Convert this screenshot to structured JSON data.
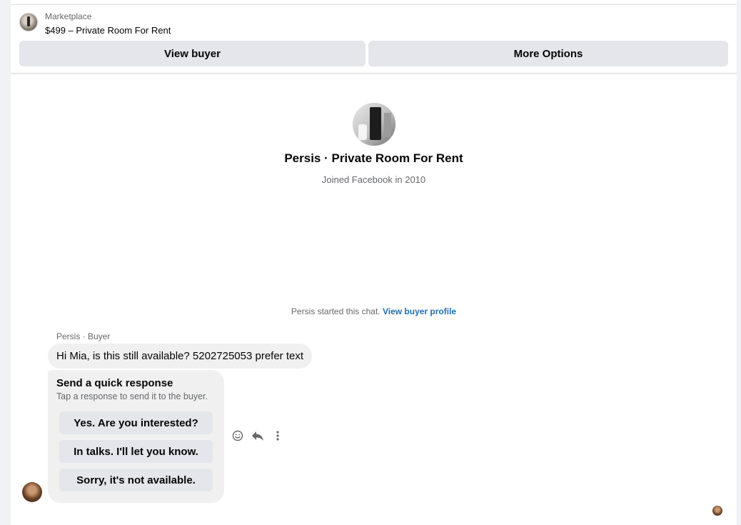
{
  "header": {
    "context_label": "Marketplace",
    "listing_title": "$499 – Private Room For Rent",
    "view_buyer_label": "View buyer",
    "more_options_label": "More Options"
  },
  "profile": {
    "name": "Persis · Private Room For Rent",
    "joined": "Joined Facebook in 2010"
  },
  "thread": {
    "started_text": "Persis started this chat.",
    "view_profile_link": "View buyer profile",
    "sender_label": "Persis · Buyer",
    "message": "Hi Mia, is this still available? 5202725053 prefer text"
  },
  "quick_response": {
    "title": "Send a quick response",
    "subtitle": "Tap a response to send it to the buyer.",
    "options": [
      "Yes. Are you interested?",
      "In talks. I'll let you know.",
      "Sorry, it's not available."
    ]
  },
  "icons": {
    "react": "smiley-icon",
    "reply": "reply-icon",
    "more": "more-vertical-icon"
  },
  "colors": {
    "link": "#1f6fb5",
    "bubble": "#f0f0f0",
    "button": "#e4e6eb",
    "secondary_text": "#65676b"
  }
}
